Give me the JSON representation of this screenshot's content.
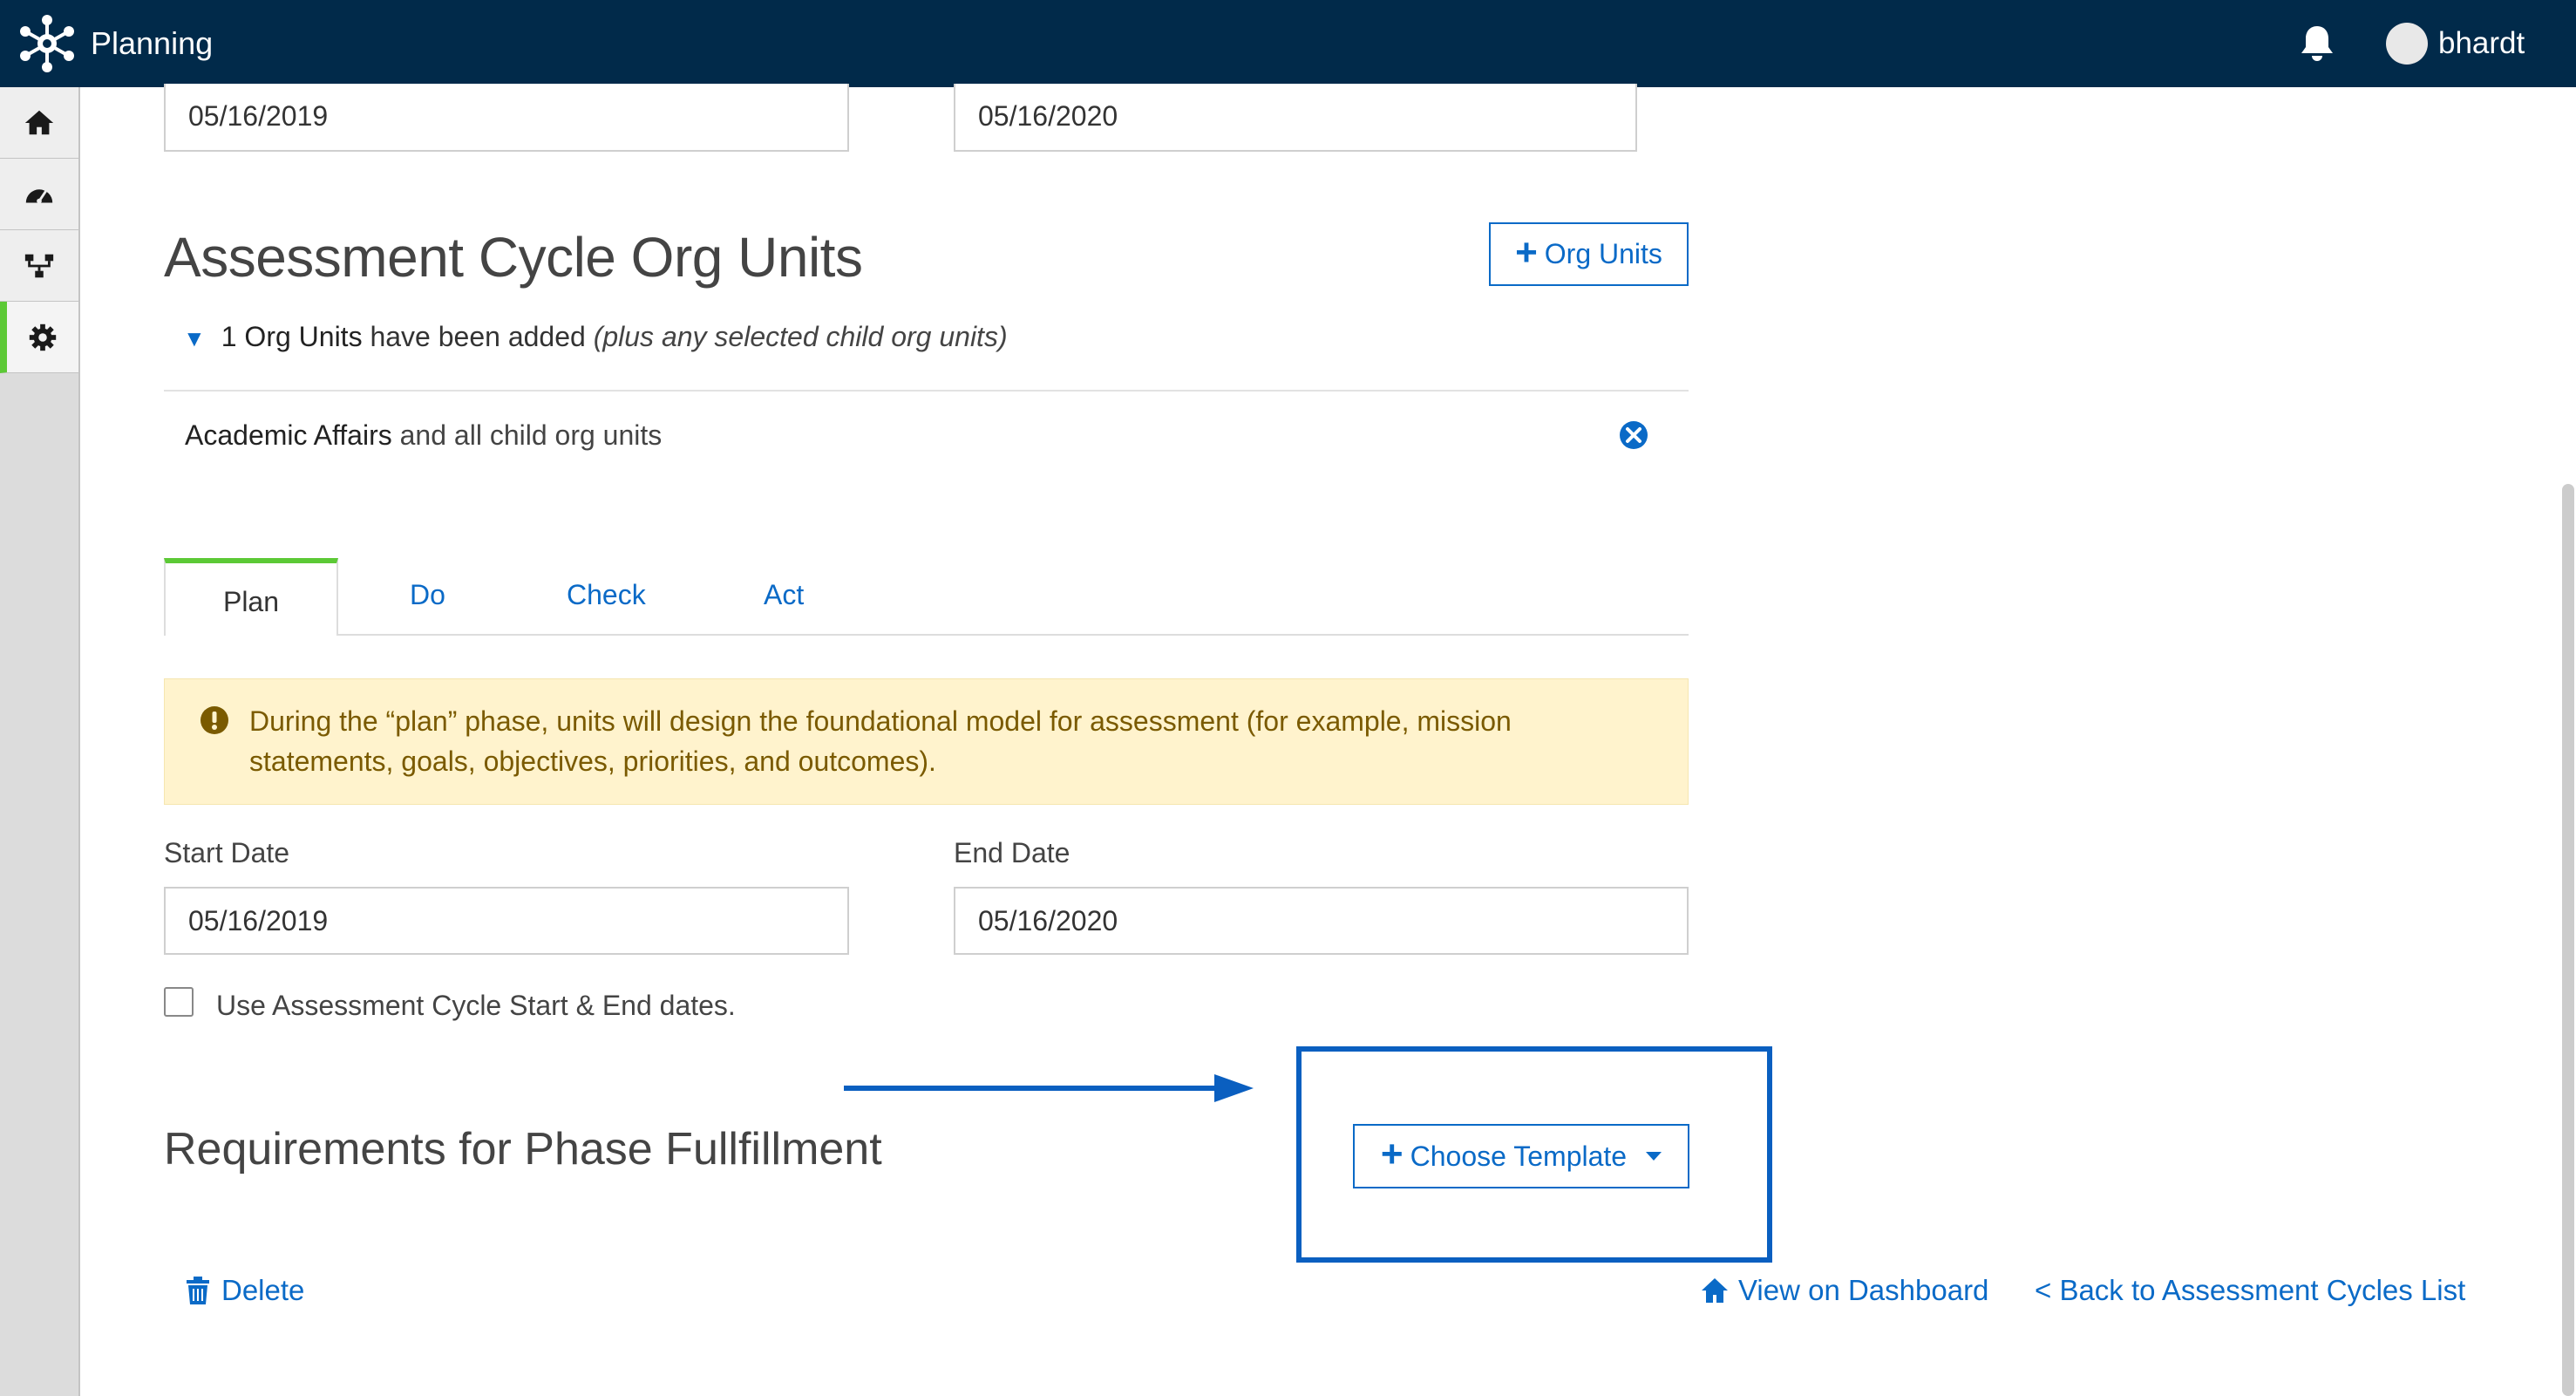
{
  "header": {
    "app_title": "Planning",
    "username": "bhardt",
    "logo_icon": "network-logo-icon",
    "notification_icon": "bell-icon"
  },
  "sidebar": {
    "items": [
      {
        "icon": "home-icon",
        "active": false
      },
      {
        "icon": "dashboard-gauge-icon",
        "active": false
      },
      {
        "icon": "org-tree-icon",
        "active": false
      },
      {
        "icon": "gear-icon",
        "active": true
      }
    ]
  },
  "cycle_dates": {
    "start_value": "05/16/2019",
    "end_value": "05/16/2020"
  },
  "org_units": {
    "title": "Assessment Cycle Org Units",
    "add_button_label": "Org Units",
    "summary_count": "1 Org Units",
    "summary_text": " have been added ",
    "summary_note": "(plus any selected child org units)",
    "rows": [
      {
        "name": "Academic Affairs",
        "suffix": " and all child org units"
      }
    ]
  },
  "tabs": [
    {
      "label": "Plan",
      "active": true
    },
    {
      "label": "Do",
      "active": false
    },
    {
      "label": "Check",
      "active": false
    },
    {
      "label": "Act",
      "active": false
    }
  ],
  "alert": {
    "text": "During the “plan” phase, units will design the foundational model for assessment (for example, mission statements, goals, objectives, priorities, and outcomes)."
  },
  "phase_dates": {
    "start_label": "Start Date",
    "start_value": "05/16/2019",
    "end_label": "End Date",
    "end_value": "05/16/2020"
  },
  "checkbox": {
    "label": "Use Assessment Cycle Start & End dates.",
    "checked": false
  },
  "requirements": {
    "title": "Requirements for Phase Fullfillment",
    "choose_template_label": "Choose Template"
  },
  "footer": {
    "delete_label": "Delete",
    "dashboard_label": "View on Dashboard",
    "back_label": "< Back to Assessment Cycles List"
  },
  "colors": {
    "topbar": "#012a4a",
    "accent": "#0a6ac7",
    "active_green": "#5cc936",
    "alert_bg": "#fff3cd"
  }
}
